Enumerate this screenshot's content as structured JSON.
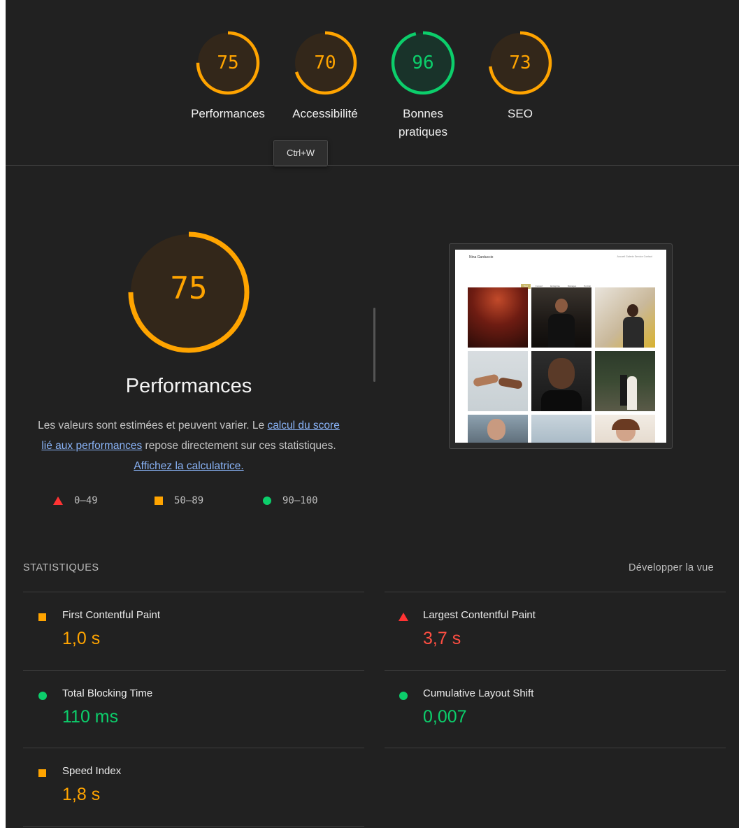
{
  "tooltip": "Ctrl+W",
  "colors": {
    "orange": "#ffa400",
    "green": "#0cce6b",
    "red": "#ff4e42",
    "bg": "#212121"
  },
  "gauges": [
    {
      "label": "Performances",
      "score": 75,
      "rating": "average"
    },
    {
      "label": "Accessibilité",
      "score": 70,
      "rating": "average"
    },
    {
      "label": "Bonnes pratiques",
      "score": 96,
      "rating": "pass"
    },
    {
      "label": "SEO",
      "score": 73,
      "rating": "average"
    }
  ],
  "main": {
    "score": 75,
    "title": "Performances",
    "desc_1": "Les valeurs sont estimées et peuvent varier. Le ",
    "link_1": "calcul du score lié aux performances",
    "desc_2": " repose directement sur ces statistiques. ",
    "link_2": "Affichez la calculatrice."
  },
  "legend": [
    {
      "icon": "triangle-fail-icon",
      "range": "0–49"
    },
    {
      "icon": "square-average-icon",
      "range": "50–89"
    },
    {
      "icon": "circle-pass-icon",
      "range": "90–100"
    }
  ],
  "thumbnail": {
    "brand": "Nina Garduccio",
    "nav": "Accueil  Galerie  Service  Contact",
    "filters": [
      "Tout",
      "Concert",
      "Entreprise",
      "Mariages",
      "Portrait"
    ]
  },
  "stats": {
    "title": "STATISTIQUES",
    "toggle": "Développer la vue",
    "metrics": [
      {
        "name": "First Contentful Paint",
        "value": "1,0 s",
        "rating": "average"
      },
      {
        "name": "Largest Contentful Paint",
        "value": "3,7 s",
        "rating": "fail"
      },
      {
        "name": "Total Blocking Time",
        "value": "110 ms",
        "rating": "pass"
      },
      {
        "name": "Cumulative Layout Shift",
        "value": "0,007",
        "rating": "pass"
      },
      {
        "name": "Speed Index",
        "value": "1,8 s",
        "rating": "average"
      }
    ]
  }
}
